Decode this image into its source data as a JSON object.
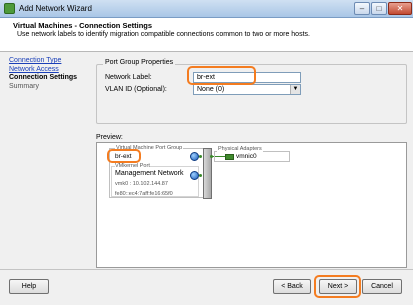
{
  "window": {
    "title": "Add Network Wizard",
    "minimize_glyph": "–",
    "maximize_glyph": "□",
    "close_glyph": "✕"
  },
  "header": {
    "title": "Virtual Machines - Connection Settings",
    "description": "Use network labels to identify migration compatible connections common to two or more hosts."
  },
  "nav": {
    "items": [
      {
        "label": "Connection Type",
        "state": "link"
      },
      {
        "label": "Network Access",
        "state": "link"
      },
      {
        "label": "Connection Settings",
        "state": "current"
      },
      {
        "label": "Summary",
        "state": "future"
      }
    ]
  },
  "port_group": {
    "legend": "Port Group Properties",
    "network_label_label": "Network Label:",
    "network_label_value": "br-ext",
    "vlan_label": "VLAN ID (Optional):",
    "vlan_value": "None (0)"
  },
  "preview": {
    "label": "Preview:",
    "vm_port_group_title": "Virtual Machine Port Group",
    "port_group_name": "br-ext",
    "vmkernel_title": "VMkernel Port",
    "vmkernel_name": "Management Network",
    "vmk_ip": "vmk0 : 10.102.144.87",
    "vmk_ipv6": "fe80::ec4:7aff:fe16:65f0",
    "physical_adapters_title": "Physical Adapters",
    "nic_name": "vmnic0"
  },
  "footer": {
    "help_label": "Help",
    "back_label": "< Back",
    "next_label": "Next >",
    "cancel_label": "Cancel"
  },
  "colors": {
    "highlight": "#f47c20",
    "link": "#1a3fb8",
    "network_green": "#3a8a2a"
  },
  "icons": [
    "app-icon",
    "globe-icon",
    "nic-icon",
    "dropdown-arrow-icon"
  ]
}
